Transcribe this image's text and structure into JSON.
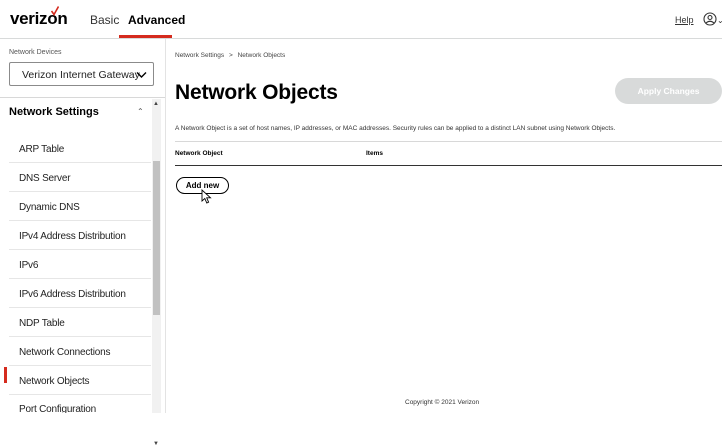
{
  "header": {
    "logo_text": "verizon",
    "tabs": [
      {
        "label": "Basic",
        "active": false
      },
      {
        "label": "Advanced",
        "active": true
      }
    ],
    "help_label": "Help",
    "accent_color": "#d52b1e"
  },
  "sidebar": {
    "device_label": "Network Devices",
    "device_selected": "Verizon Internet Gateway",
    "section_title": "Network Settings",
    "items": [
      {
        "label": "ARP Table"
      },
      {
        "label": "DNS Server"
      },
      {
        "label": "Dynamic DNS"
      },
      {
        "label": "IPv4 Address Distribution"
      },
      {
        "label": "IPv6"
      },
      {
        "label": "IPv6 Address Distribution"
      },
      {
        "label": "NDP Table"
      },
      {
        "label": "Network Connections"
      },
      {
        "label": "Network Objects",
        "active": true
      },
      {
        "label": "Port Configuration"
      }
    ]
  },
  "main": {
    "breadcrumb": [
      "Network Settings",
      "Network Objects"
    ],
    "breadcrumb_separator": ">",
    "title": "Network Objects",
    "apply_label": "Apply Changes",
    "description": "A Network Object is a set of host names, IP addresses, or MAC addresses. Security rules can be applied to a distinct LAN subnet using Network Objects.",
    "table_headers": [
      "Network Object",
      "Items"
    ],
    "add_label": "Add new"
  },
  "footer": {
    "copyright": "Copyright © 2021 Verizon"
  }
}
